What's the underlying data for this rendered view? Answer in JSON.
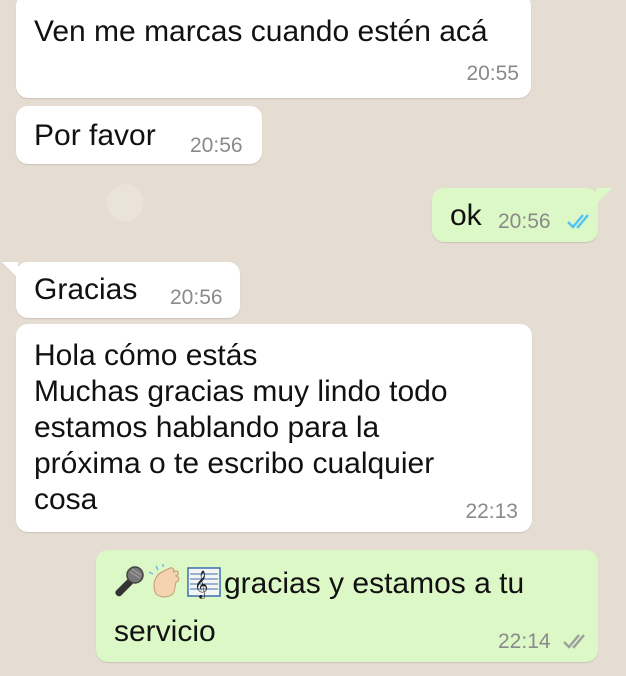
{
  "colors": {
    "incoming_bg": "#ffffff",
    "outgoing_bg": "#dcf8c6",
    "timestamp": "#8a8a8a",
    "read_ticks": "#4fc3f7",
    "delivered_ticks": "#9e9e9e"
  },
  "messages": [
    {
      "direction": "in",
      "text": "Ven me marcas cuando estén acá",
      "time": "20:55"
    },
    {
      "direction": "in",
      "text": "Por favor",
      "time": "20:56"
    },
    {
      "direction": "out",
      "text": "ok",
      "time": "20:56",
      "status_icon": "double-check-read-icon"
    },
    {
      "direction": "in",
      "text": "Gracias",
      "time": "20:56"
    },
    {
      "direction": "in",
      "lines": [
        "Hola cómo estás",
        "Muchas gracias muy lindo todo",
        "estamos hablando para la",
        "próxima o te escribo cualquier",
        "cosa"
      ],
      "time": "22:13"
    },
    {
      "direction": "out",
      "emojis": [
        "microphone-icon",
        "clapping-hands-icon",
        "musical-score-icon"
      ],
      "text_line1": "gracias y estamos a tu",
      "text_line2": "servicio",
      "time": "22:14",
      "status_icon": "double-check-delivered-icon"
    }
  ]
}
